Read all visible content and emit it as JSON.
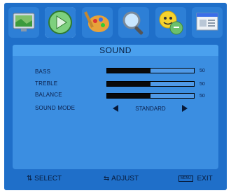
{
  "nav_icons": [
    {
      "name": "picture-icon",
      "selected": false
    },
    {
      "name": "sound-icon",
      "selected": true
    },
    {
      "name": "setup-icon",
      "selected": false
    },
    {
      "name": "search-icon",
      "selected": false
    },
    {
      "name": "parental-icon",
      "selected": false
    },
    {
      "name": "window-icon",
      "selected": false
    }
  ],
  "menu": {
    "title": "SOUND",
    "bass": {
      "label": "BASS",
      "value": "50",
      "level": 0.5
    },
    "treble": {
      "label": "TREBLE",
      "value": "50",
      "level": 0.5
    },
    "balance": {
      "label": "BALANCE",
      "value": "50",
      "level": 0.5
    },
    "sound_mode": {
      "label": "SOUND MODE",
      "value": "STANDARD"
    }
  },
  "footer": {
    "select_icon": "⇅",
    "select": "SELECT",
    "adjust_icon": "⇆",
    "adjust": "ADJUST",
    "menu_key": "MENU",
    "exit": "EXIT"
  },
  "colors": {
    "frame": "#1f6fc9",
    "panel": "#3b8ee1",
    "title_bar": "#4aa0ee",
    "bar_fill": "#0a0a0a"
  }
}
